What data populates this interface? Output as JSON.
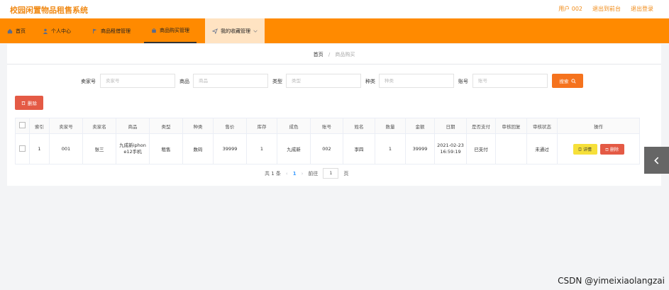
{
  "app": {
    "title": "校园闲置物品租售系统"
  },
  "top_links": [
    "用户 002",
    "退出到前台",
    "退出登录"
  ],
  "nav": [
    {
      "label": "首页",
      "icon": "home-icon"
    },
    {
      "label": "个人中心",
      "icon": "user-icon"
    },
    {
      "label": "商品租借管理",
      "icon": "flag-icon"
    },
    {
      "label": "商品购买管理",
      "icon": "bag-icon"
    },
    {
      "label": "我的收藏管理",
      "icon": "send-icon"
    }
  ],
  "breadcrumb": {
    "home": "首页",
    "sep": "/",
    "current": "商品购买"
  },
  "filters": [
    {
      "label": "卖家号",
      "placeholder": "卖家号"
    },
    {
      "label": "商品",
      "placeholder": "商品"
    },
    {
      "label": "类型",
      "placeholder": "类型"
    },
    {
      "label": "种类",
      "placeholder": "种类"
    },
    {
      "label": "账号",
      "placeholder": "账号"
    }
  ],
  "search_button": "搜索",
  "delete_button": "删除",
  "table": {
    "headers": [
      "",
      "索引",
      "卖家号",
      "卖家名",
      "商品",
      "类型",
      "种类",
      "售价",
      "库存",
      "成色",
      "账号",
      "姓名",
      "数量",
      "金额",
      "日期",
      "是否支付",
      "审核回复",
      "审核状态",
      "操作"
    ],
    "rows": [
      {
        "index": "1",
        "seller_no": "001",
        "seller_name": "张三",
        "product": "九成新iphone12手机",
        "type": "租售",
        "category": "数码",
        "price": "39999",
        "stock": "1",
        "condition": "九成新",
        "account": "002",
        "name": "李四",
        "quantity": "1",
        "amount": "39999",
        "date": "2021-02-23 16:59:19",
        "paid": "已支付",
        "reply": "",
        "status": "未通过",
        "detail_label": "详情",
        "delete_label": "删除"
      }
    ]
  },
  "pagination": {
    "total": "共 1 条",
    "current": "1",
    "goto": "前往",
    "goto_value": "1",
    "page_unit": "页"
  },
  "watermark": "CSDN @yimeixiaolangzai",
  "colors": {
    "brand": "#ff8a00",
    "accent_text": "#f08a16",
    "search_btn": "#f5731e",
    "delete_btn": "#e45a45",
    "detail_btn": "#f6e03a"
  }
}
